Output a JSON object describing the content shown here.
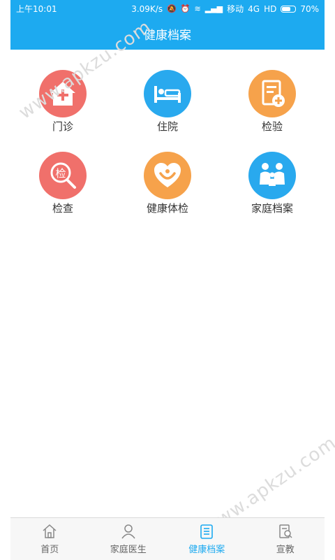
{
  "status_bar": {
    "time": "上午10:01",
    "speed": "3.09K/s",
    "carrier": "移动",
    "network": "4G",
    "hd": "HD",
    "battery_label": "70%",
    "battery_level": 0.7
  },
  "header": {
    "title": "健康档案"
  },
  "tiles": [
    {
      "label": "门诊",
      "color": "#f0706b",
      "icon": "clinic-icon"
    },
    {
      "label": "住院",
      "color": "#29a9ee",
      "icon": "bed-icon"
    },
    {
      "label": "检验",
      "color": "#f6a24b",
      "icon": "lab-report-icon"
    },
    {
      "label": "检查",
      "color": "#f0706b",
      "icon": "exam-search-icon",
      "icon_text": "检"
    },
    {
      "label": "健康体检",
      "color": "#f6a24b",
      "icon": "heart-checkup-icon"
    },
    {
      "label": "家庭档案",
      "color": "#29a9ee",
      "icon": "family-icon"
    }
  ],
  "watermark": "www.apkzu.com",
  "bottom_nav": {
    "items": [
      {
        "label": "首页",
        "icon": "home-icon",
        "active": false
      },
      {
        "label": "家庭医生",
        "icon": "person-icon",
        "active": false
      },
      {
        "label": "健康档案",
        "icon": "records-icon",
        "active": true
      },
      {
        "label": "宣教",
        "icon": "education-icon",
        "active": false
      }
    ]
  },
  "colors": {
    "accent": "#1daaf0",
    "text": "#333333",
    "nav_text": "#666666"
  }
}
